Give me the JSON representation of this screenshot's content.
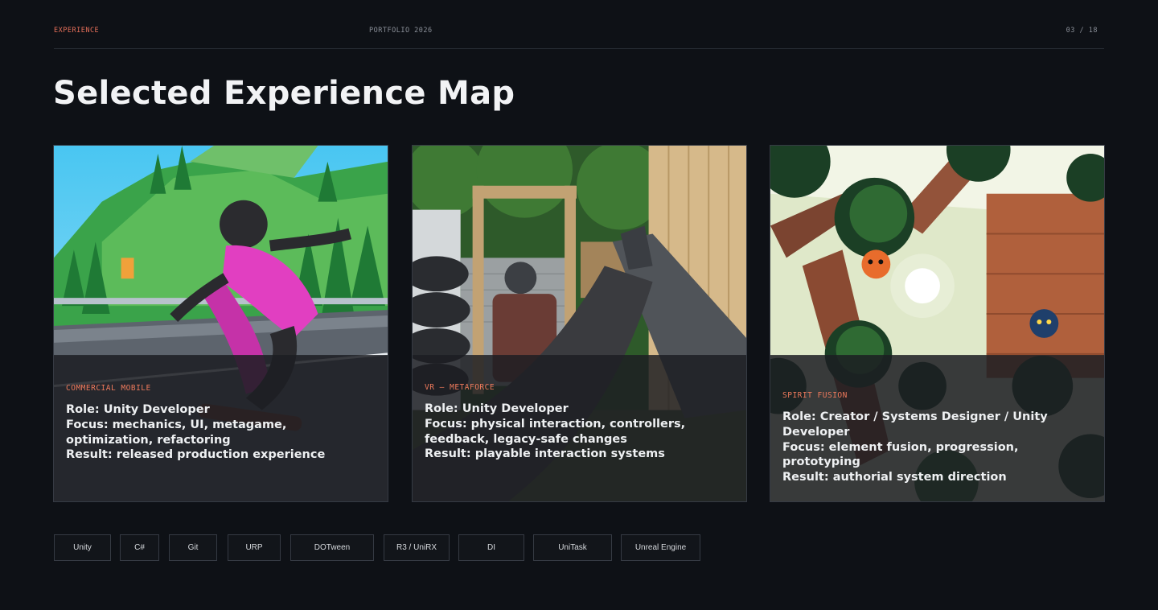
{
  "header": {
    "section": "EXPERIENCE",
    "portfolio": "PORTFOLIO 2026",
    "page": "03 / 18"
  },
  "title": "Selected Experience Map",
  "cards": [
    {
      "tag": "COMMERCIAL MOBILE",
      "role": "Role: Unity Developer",
      "focus": "Focus: mechanics, UI, metagame, optimization, refactoring",
      "result": "Result: released production experience"
    },
    {
      "tag": "VR — METAFORCE",
      "role": "Role: Unity Developer",
      "focus": "Focus: physical interaction, controllers, feedback, legacy-safe changes",
      "result": "Result: playable interaction systems"
    },
    {
      "tag": "SPIRIT FUSION",
      "role": "Role: Creator / Systems Designer / Unity Developer",
      "focus": "Focus: element fusion, progression, prototyping",
      "result": "Result: authorial system direction"
    }
  ],
  "skills": [
    "Unity",
    "C#",
    "Git",
    "URP",
    "DOTween",
    "R3 / UniRX",
    "DI",
    "UniTask",
    "Unreal Engine"
  ],
  "colors": {
    "accent": "#e8705a",
    "background": "#0e1116",
    "text": "#eef0f2"
  }
}
